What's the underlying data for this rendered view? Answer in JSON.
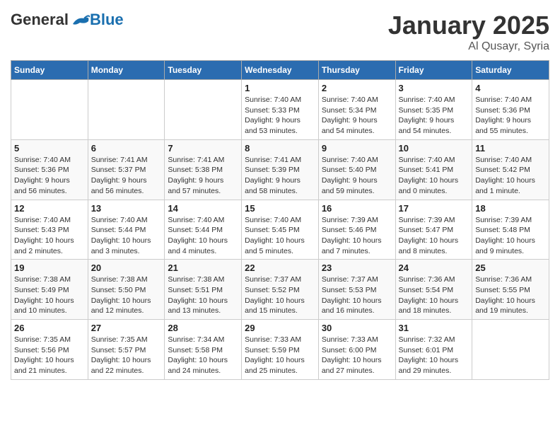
{
  "header": {
    "logo": {
      "general": "General",
      "blue": "Blue"
    },
    "title": "January 2025",
    "location": "Al Qusayr, Syria"
  },
  "weekdays": [
    "Sunday",
    "Monday",
    "Tuesday",
    "Wednesday",
    "Thursday",
    "Friday",
    "Saturday"
  ],
  "weeks": [
    [
      {
        "day": "",
        "info": ""
      },
      {
        "day": "",
        "info": ""
      },
      {
        "day": "",
        "info": ""
      },
      {
        "day": "1",
        "info": "Sunrise: 7:40 AM\nSunset: 5:33 PM\nDaylight: 9 hours\nand 53 minutes."
      },
      {
        "day": "2",
        "info": "Sunrise: 7:40 AM\nSunset: 5:34 PM\nDaylight: 9 hours\nand 54 minutes."
      },
      {
        "day": "3",
        "info": "Sunrise: 7:40 AM\nSunset: 5:35 PM\nDaylight: 9 hours\nand 54 minutes."
      },
      {
        "day": "4",
        "info": "Sunrise: 7:40 AM\nSunset: 5:36 PM\nDaylight: 9 hours\nand 55 minutes."
      }
    ],
    [
      {
        "day": "5",
        "info": "Sunrise: 7:40 AM\nSunset: 5:36 PM\nDaylight: 9 hours\nand 56 minutes."
      },
      {
        "day": "6",
        "info": "Sunrise: 7:41 AM\nSunset: 5:37 PM\nDaylight: 9 hours\nand 56 minutes."
      },
      {
        "day": "7",
        "info": "Sunrise: 7:41 AM\nSunset: 5:38 PM\nDaylight: 9 hours\nand 57 minutes."
      },
      {
        "day": "8",
        "info": "Sunrise: 7:41 AM\nSunset: 5:39 PM\nDaylight: 9 hours\nand 58 minutes."
      },
      {
        "day": "9",
        "info": "Sunrise: 7:40 AM\nSunset: 5:40 PM\nDaylight: 9 hours\nand 59 minutes."
      },
      {
        "day": "10",
        "info": "Sunrise: 7:40 AM\nSunset: 5:41 PM\nDaylight: 10 hours\nand 0 minutes."
      },
      {
        "day": "11",
        "info": "Sunrise: 7:40 AM\nSunset: 5:42 PM\nDaylight: 10 hours\nand 1 minute."
      }
    ],
    [
      {
        "day": "12",
        "info": "Sunrise: 7:40 AM\nSunset: 5:43 PM\nDaylight: 10 hours\nand 2 minutes."
      },
      {
        "day": "13",
        "info": "Sunrise: 7:40 AM\nSunset: 5:44 PM\nDaylight: 10 hours\nand 3 minutes."
      },
      {
        "day": "14",
        "info": "Sunrise: 7:40 AM\nSunset: 5:44 PM\nDaylight: 10 hours\nand 4 minutes."
      },
      {
        "day": "15",
        "info": "Sunrise: 7:40 AM\nSunset: 5:45 PM\nDaylight: 10 hours\nand 5 minutes."
      },
      {
        "day": "16",
        "info": "Sunrise: 7:39 AM\nSunset: 5:46 PM\nDaylight: 10 hours\nand 7 minutes."
      },
      {
        "day": "17",
        "info": "Sunrise: 7:39 AM\nSunset: 5:47 PM\nDaylight: 10 hours\nand 8 minutes."
      },
      {
        "day": "18",
        "info": "Sunrise: 7:39 AM\nSunset: 5:48 PM\nDaylight: 10 hours\nand 9 minutes."
      }
    ],
    [
      {
        "day": "19",
        "info": "Sunrise: 7:38 AM\nSunset: 5:49 PM\nDaylight: 10 hours\nand 10 minutes."
      },
      {
        "day": "20",
        "info": "Sunrise: 7:38 AM\nSunset: 5:50 PM\nDaylight: 10 hours\nand 12 minutes."
      },
      {
        "day": "21",
        "info": "Sunrise: 7:38 AM\nSunset: 5:51 PM\nDaylight: 10 hours\nand 13 minutes."
      },
      {
        "day": "22",
        "info": "Sunrise: 7:37 AM\nSunset: 5:52 PM\nDaylight: 10 hours\nand 15 minutes."
      },
      {
        "day": "23",
        "info": "Sunrise: 7:37 AM\nSunset: 5:53 PM\nDaylight: 10 hours\nand 16 minutes."
      },
      {
        "day": "24",
        "info": "Sunrise: 7:36 AM\nSunset: 5:54 PM\nDaylight: 10 hours\nand 18 minutes."
      },
      {
        "day": "25",
        "info": "Sunrise: 7:36 AM\nSunset: 5:55 PM\nDaylight: 10 hours\nand 19 minutes."
      }
    ],
    [
      {
        "day": "26",
        "info": "Sunrise: 7:35 AM\nSunset: 5:56 PM\nDaylight: 10 hours\nand 21 minutes."
      },
      {
        "day": "27",
        "info": "Sunrise: 7:35 AM\nSunset: 5:57 PM\nDaylight: 10 hours\nand 22 minutes."
      },
      {
        "day": "28",
        "info": "Sunrise: 7:34 AM\nSunset: 5:58 PM\nDaylight: 10 hours\nand 24 minutes."
      },
      {
        "day": "29",
        "info": "Sunrise: 7:33 AM\nSunset: 5:59 PM\nDaylight: 10 hours\nand 25 minutes."
      },
      {
        "day": "30",
        "info": "Sunrise: 7:33 AM\nSunset: 6:00 PM\nDaylight: 10 hours\nand 27 minutes."
      },
      {
        "day": "31",
        "info": "Sunrise: 7:32 AM\nSunset: 6:01 PM\nDaylight: 10 hours\nand 29 minutes."
      },
      {
        "day": "",
        "info": ""
      }
    ]
  ]
}
